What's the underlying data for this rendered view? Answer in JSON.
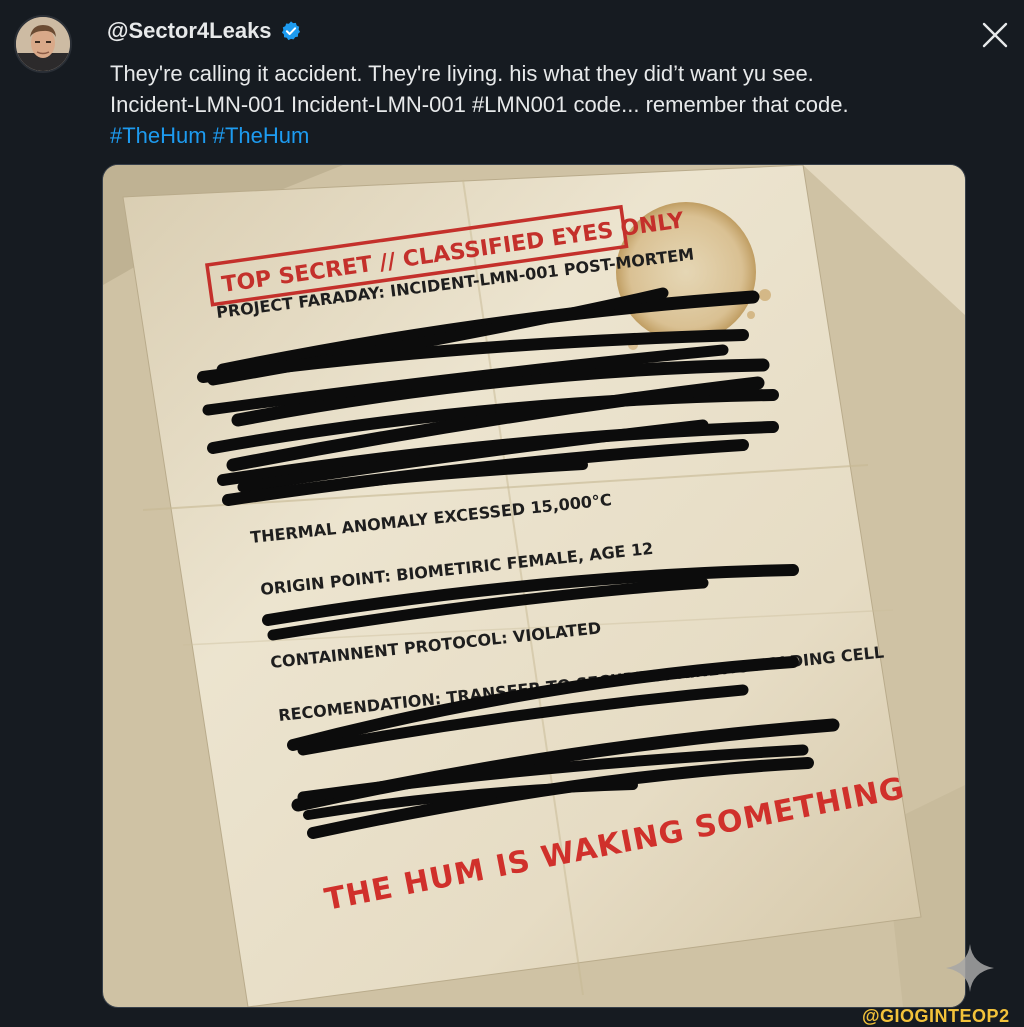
{
  "post": {
    "handle": "@Sector4Leaks",
    "text_line1": "They're calling it accident. They're liying. his what they did’t want yu see.",
    "text_line2": "Incident-LMN-001 Incident-LMN-001 #LMN001 code... remember that code.",
    "hashtags": [
      "#TheHum",
      "#TheHum"
    ]
  },
  "document": {
    "stamp": "TOP SECRET // CLASSIFIED EYES ONLY",
    "project_line": "PROJECT FARADAY: INCIDENT-LMN-001 POST-MORTEM",
    "line_thermal": "THERMAL ANOMALY EXCESSED 15,000°C",
    "line_origin": "ORIGIN POINT: BIOMETIRIC FEMALE, AGE 12",
    "line_containment": "CONTAINNENT PROTOCOL: VIOLATED",
    "line_recommendation": "RECOMENDATION: TRANSFER TO SECURE BI-KINETIC HOLDING CELL",
    "handwritten": "THE HUM IS WAKING SOMETHING"
  },
  "watermark": "@GIOGINTEOP2",
  "icons": {
    "close": "close-icon",
    "verified": "verified-badge-icon",
    "sparkle": "sparkle-icon",
    "avatar": "avatar"
  },
  "colors": {
    "background": "#161b21",
    "link": "#1d9bf0",
    "verified": "#1d9bf0",
    "stamp_red": "#c4302b",
    "paper": "#e9e0cb",
    "redaction": "#0c0c0c"
  }
}
